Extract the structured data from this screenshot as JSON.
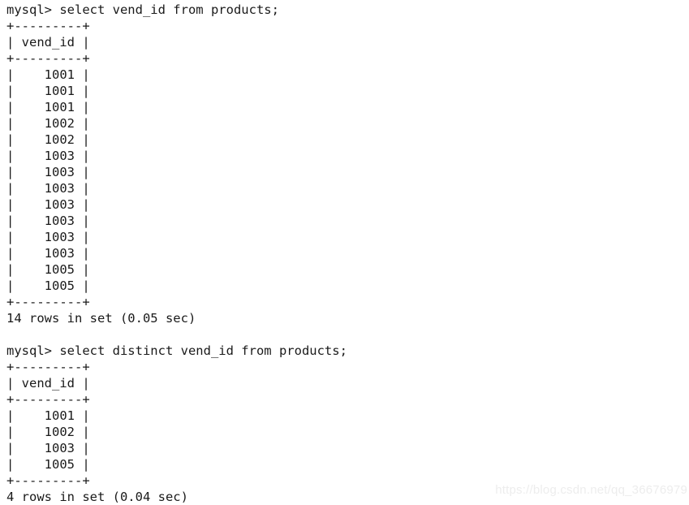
{
  "terminal": {
    "prompt": "mysql>",
    "background_color": "#ffffff",
    "text_color": "#1a1a1a",
    "blocks": [
      {
        "name": "query-block-1",
        "command_line": "mysql> select vend_id from products;",
        "command_sql": "select vend_id from products;",
        "table": {
          "border_top": "+---------+",
          "header_row": "| vend_id |",
          "border_mid": "+---------+",
          "column_header": "vend_id",
          "rows": [
            "|    1001 |",
            "|    1001 |",
            "|    1001 |",
            "|    1002 |",
            "|    1002 |",
            "|    1003 |",
            "|    1003 |",
            "|    1003 |",
            "|    1003 |",
            "|    1003 |",
            "|    1003 |",
            "|    1003 |",
            "|    1005 |",
            "|    1005 |"
          ],
          "values": [
            1001,
            1001,
            1001,
            1002,
            1002,
            1003,
            1003,
            1003,
            1003,
            1003,
            1003,
            1003,
            1005,
            1005
          ],
          "border_bottom": "+---------+"
        },
        "status_line": "14 rows in set (0.05 sec)",
        "row_count": 14,
        "elapsed": "0.05 sec"
      },
      {
        "name": "query-block-2",
        "command_line": "mysql> select distinct vend_id from products;",
        "command_sql": "select distinct vend_id from products;",
        "table": {
          "border_top": "+---------+",
          "header_row": "| vend_id |",
          "border_mid": "+---------+",
          "column_header": "vend_id",
          "rows": [
            "|    1001 |",
            "|    1002 |",
            "|    1003 |",
            "|    1005 |"
          ],
          "values": [
            1001,
            1002,
            1003,
            1005
          ],
          "border_bottom": "+---------+"
        },
        "status_line": "4 rows in set (0.04 sec)",
        "row_count": 4,
        "elapsed": "0.04 sec"
      }
    ],
    "blank_separator": " "
  },
  "watermark": {
    "text": "https://blog.csdn.net/qq_36676979",
    "color": "#ededed"
  }
}
